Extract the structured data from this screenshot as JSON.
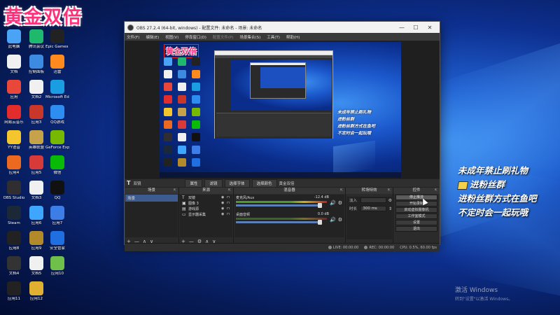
{
  "watermark_top": "黄金双倍",
  "desktop_icons": [
    {
      "label": "此电脑",
      "color": "#4aa3f5"
    },
    {
      "label": "腾讯会议",
      "color": "#1fb96d"
    },
    {
      "label": "Epic Games Launcher",
      "color": "#222222"
    },
    {
      "label": "文档",
      "color": "#f0f0f0"
    },
    {
      "label": "控制面板",
      "color": "#3d8be0"
    },
    {
      "label": "迅雷",
      "color": "#ff8a1e"
    },
    {
      "label": "应用",
      "color": "#e8473a"
    },
    {
      "label": "文档2",
      "color": "#f0f0f0"
    },
    {
      "label": "Microsoft Edge",
      "color": "#1b9de2"
    },
    {
      "label": "网易云音乐",
      "color": "#e32d2d"
    },
    {
      "label": "应用3",
      "color": "#c9362a"
    },
    {
      "label": "QQ游戏",
      "color": "#2e8df0"
    },
    {
      "label": "YY语音",
      "color": "#f5c52e"
    },
    {
      "label": "英雄联盟",
      "color": "#c6a24b"
    },
    {
      "label": "GeForce Experience",
      "color": "#76b900"
    },
    {
      "label": "应用4",
      "color": "#ec6a20"
    },
    {
      "label": "应用5",
      "color": "#d83a3a"
    },
    {
      "label": "微信",
      "color": "#09bb07"
    },
    {
      "label": "OBS Studio",
      "color": "#302e31"
    },
    {
      "label": "文档3",
      "color": "#f0f0f0"
    },
    {
      "label": "QQ",
      "color": "#111111"
    },
    {
      "label": "Steam",
      "color": "#1b2838"
    },
    {
      "label": "应用6",
      "color": "#3ea6ff"
    },
    {
      "label": "应用7",
      "color": "#3d7ee6"
    },
    {
      "label": "应用8",
      "color": "#222222"
    },
    {
      "label": "应用9",
      "color": "#b38a2a"
    },
    {
      "label": "安全管家",
      "color": "#1f6fe0"
    },
    {
      "label": "文档4",
      "color": "#333333"
    },
    {
      "label": "文档5",
      "color": "#f0f0f0"
    },
    {
      "label": "应用10",
      "color": "#6fc04a"
    },
    {
      "label": "应用11",
      "color": "#222222"
    },
    {
      "label": "应用12",
      "color": "#e0b030"
    }
  ],
  "obs": {
    "title": "OBS 27.2.4 (64-bit, windows) - 配置文件: 未命名 - 场景: 未命名",
    "menu": [
      "文件(F)",
      "编辑(E)",
      "视图(V)",
      "停靠窗口(D)",
      "配置文件(P)",
      "场景集合(S)",
      "工具(T)",
      "帮助(H)"
    ],
    "preview_watermark": "黄金双倍",
    "preview_overlay_lines": [
      "未成年禁止刷礼物",
      "进粉丝群",
      "进粉丝群方式在鱼吧",
      "不定时会一起玩哦"
    ],
    "sourcebar": {
      "name": "双镜",
      "btn_properties": "属性",
      "btn_filters": "滤镜",
      "btn_select_text": "选择字体",
      "btn_select_color": "选择颜色",
      "sep_label": "黄金双倍"
    },
    "docks": {
      "scenes": {
        "title": "场景",
        "items": [
          "场景"
        ]
      },
      "sources": {
        "title": "来源",
        "items": [
          {
            "icon": "T",
            "name": "双镜"
          },
          {
            "icon": "▣",
            "name": "图像 3"
          },
          {
            "icon": "▤",
            "name": "游戏源"
          },
          {
            "icon": "▭",
            "name": "显示器采集"
          }
        ]
      },
      "mixer": {
        "title": "混音器",
        "tracks": [
          {
            "name": "麦克风/Aux",
            "db": "-12.4 dB"
          },
          {
            "name": "桌面音频",
            "db": "0.0 dB"
          }
        ]
      },
      "transitions": {
        "title": "转场特效",
        "type_label": "淡入",
        "type_value": "",
        "duration_label": "时长",
        "duration_value": "300 ms"
      },
      "controls": {
        "title": "控件",
        "buttons": [
          "停止推流",
          "开始录制",
          "启动虚拟摄像机",
          "工作室模式",
          "设置",
          "退出"
        ]
      }
    },
    "status": {
      "live": "LIVE: 00:00:00",
      "rec": "REC: 00:00:00",
      "cpu": "CPU: 0.5%, 60.00 fps"
    }
  },
  "right_overlay": [
    "未成年禁止刷礼物",
    "进粉丝群",
    "进粉丝群方式在鱼吧",
    "不定时会一起玩哦"
  ],
  "activate_windows": {
    "line1": "激活 Windows",
    "line2": "转到\"设置\"以激活 Windows。"
  }
}
